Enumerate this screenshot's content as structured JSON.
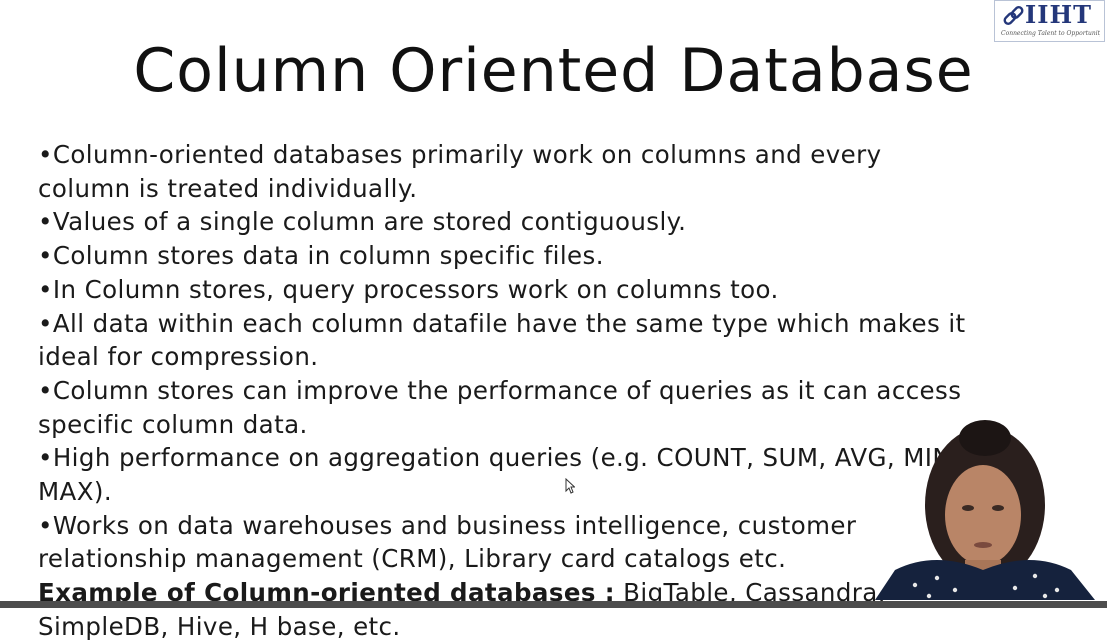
{
  "logo": {
    "name": "IIHT",
    "tagline": "Connecting Talent to Opportunity",
    "colors": {
      "primary": "#24377a"
    }
  },
  "slide": {
    "title": "Column Oriented Database",
    "bullets": [
      "•Column-oriented databases primarily work on columns and every column is treated individually.",
      "•Values of a single column are stored contiguously.",
      "•Column stores data in column specific files.",
      "•In Column stores, query processors work on columns too.",
      "•All data within each column datafile have the same type which makes it ideal for compression.",
      "•Column stores can improve the performance of queries as it can access specific column data.",
      "•High performance on aggregation queries (e.g. COUNT, SUM, AVG, MIN, MAX).",
      "•Works on data warehouses and business intelligence, customer relationship management (CRM), Library card catalogs etc."
    ],
    "example_label": "Example of Column-oriented databases :",
    "example_text": " BigTable, Cassandra, SimpleDB, Hive, H base, etc."
  }
}
